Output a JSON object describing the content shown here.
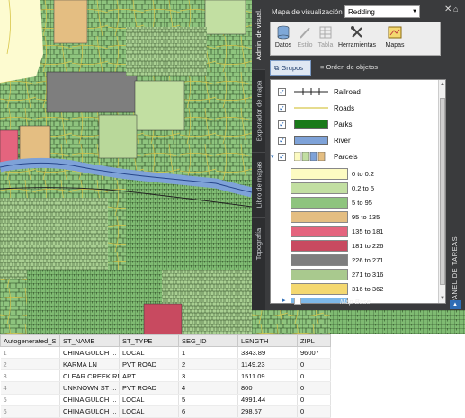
{
  "map_panel": {
    "map_selector_label": "Mapa de visualización",
    "map_selector_value": "Redding",
    "vertical_tabs": [
      "Admin. de visual.",
      "Explorador de mapa",
      "Libro de mapas",
      "Topografía"
    ],
    "toolbar": [
      {
        "label": "Datos",
        "icon": "database-icon"
      },
      {
        "label": "Estilo",
        "icon": "brush-icon"
      },
      {
        "label": "Tabla",
        "icon": "table-icon"
      },
      {
        "label": "Herramientas",
        "icon": "tools-icon"
      },
      {
        "label": "Mapas",
        "icon": "maps-icon"
      }
    ],
    "tabs": {
      "groups": "Grupos",
      "order": "Orden de objetos"
    },
    "layers": [
      {
        "name": "Railroad",
        "checked": true
      },
      {
        "name": "Roads",
        "checked": true
      },
      {
        "name": "Parks",
        "checked": true,
        "color": "#1a7a1a"
      },
      {
        "name": "River",
        "checked": true,
        "color": "#7ea2d8"
      },
      {
        "name": "Parcels",
        "checked": true
      }
    ],
    "parcel_ranges": [
      {
        "label": "0 to 0.2",
        "color": "#fdfbc2"
      },
      {
        "label": "0.2 to 5",
        "color": "#c2dfa2"
      },
      {
        "label": "5 to 95",
        "color": "#8ec47e"
      },
      {
        "label": "95 to 135",
        "color": "#e4be82"
      },
      {
        "label": "135 to 181",
        "color": "#e4647e"
      },
      {
        "label": "181 to 226",
        "color": "#c84a60"
      },
      {
        "label": "226 to 271",
        "color": "#7e7e7e"
      },
      {
        "label": "271 to 316",
        "color": "#a9c98e"
      },
      {
        "label": "316 to 362",
        "color": "#f4d870"
      },
      {
        "label": "",
        "color": "#7db8e8"
      }
    ],
    "base_map": "Map Base",
    "panel_title": "PANEL DE TAREAS"
  },
  "table": {
    "columns": [
      "Autogenerated_S",
      "ST_NAME",
      "ST_TYPE",
      "SEG_ID",
      "LENGTH",
      "ZIPL"
    ],
    "rows": [
      [
        "1",
        "CHINA GULCH ...",
        "LOCAL",
        "1",
        "3343.89",
        "96007"
      ],
      [
        "2",
        "KARMA LN",
        "PVT ROAD",
        "2",
        "1149.23",
        "0"
      ],
      [
        "3",
        "CLEAR CREEK RD",
        "ART",
        "3",
        "1511.09",
        "0"
      ],
      [
        "4",
        "UNKNOWN ST ...",
        "PVT ROAD",
        "4",
        "800",
        "0"
      ],
      [
        "5",
        "CHINA GULCH ...",
        "LOCAL",
        "5",
        "4991.44",
        "0"
      ],
      [
        "6",
        "CHINA GULCH ...",
        "LOCAL",
        "6",
        "298.57",
        "0"
      ]
    ]
  }
}
